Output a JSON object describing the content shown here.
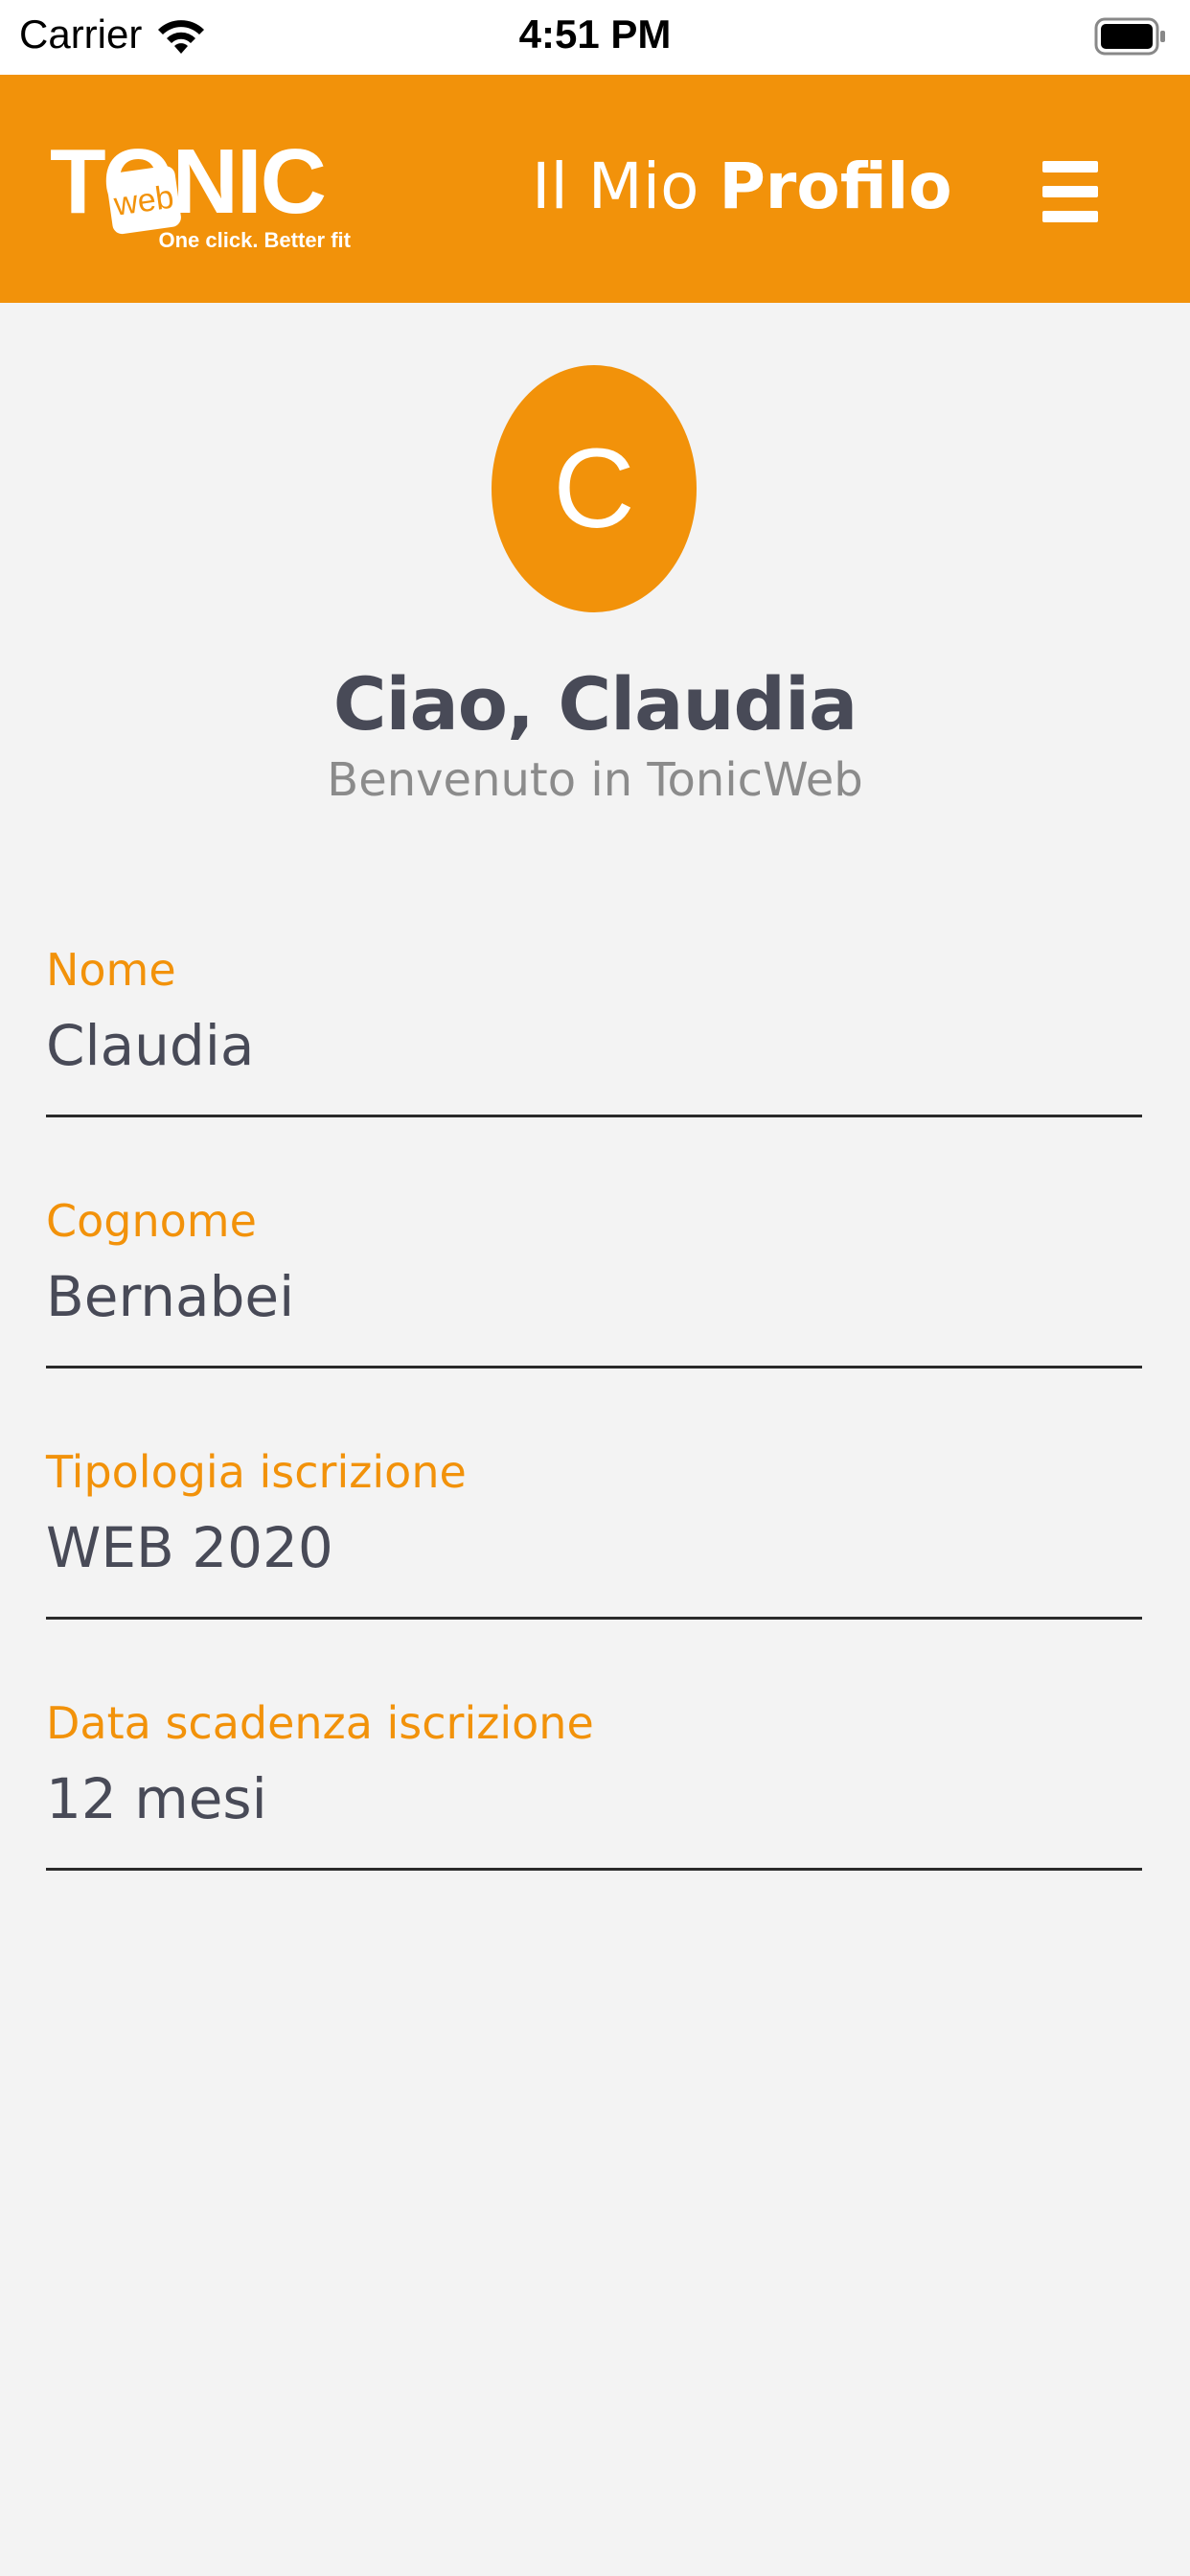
{
  "status_bar": {
    "carrier": "Carrier",
    "time": "4:51 PM"
  },
  "header": {
    "logo_text": "TONIC",
    "logo_badge": "web",
    "logo_tagline": "One click. Better fit",
    "title_light": "Il Mio",
    "title_bold": "Profilo",
    "menu_icon": "hamburger-menu-icon"
  },
  "profile": {
    "avatar_initial": "C",
    "greeting": "Ciao, Claudia",
    "welcome": "Benvenuto in TonicWeb"
  },
  "fields": [
    {
      "label": "Nome",
      "value": "Claudia"
    },
    {
      "label": "Cognome",
      "value": "Bernabei"
    },
    {
      "label": "Tipologia iscrizione",
      "value": "WEB 2020"
    },
    {
      "label": "Data scadenza iscrizione",
      "value": "12 mesi"
    }
  ],
  "colors": {
    "accent": "#f2920a",
    "background": "#f3f3f3",
    "text_dark": "#484a57",
    "text_muted": "#8b8b8b"
  }
}
